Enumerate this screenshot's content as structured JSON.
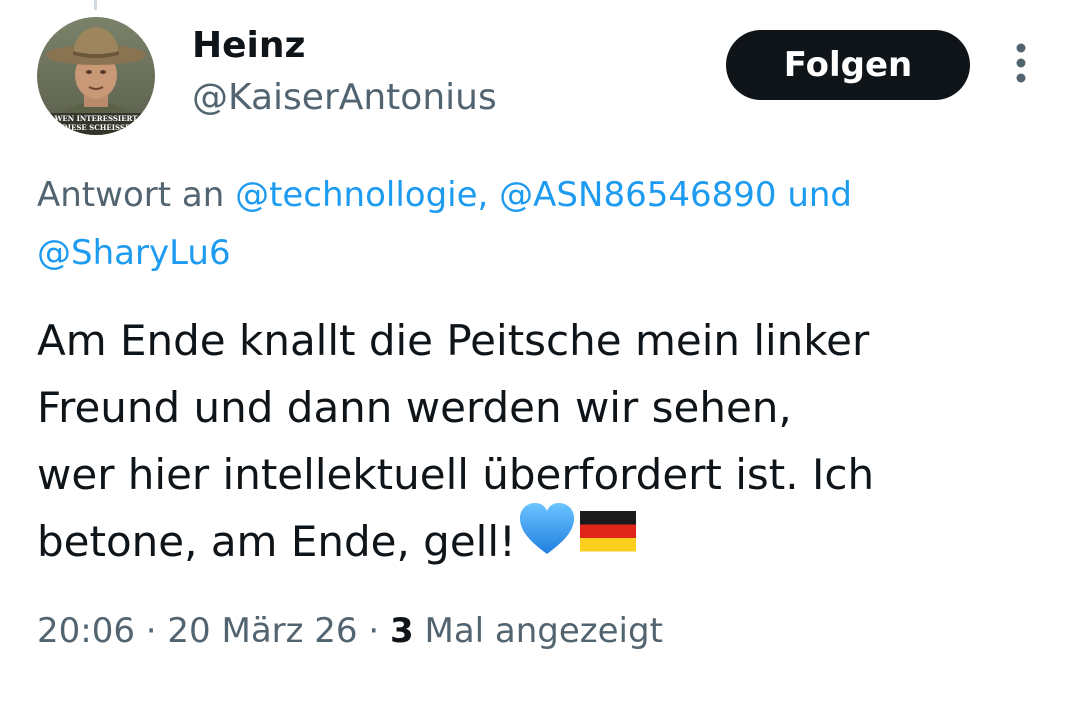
{
  "author": {
    "display_name": "Heinz",
    "handle": "@KaiserAntonius",
    "avatar_caption_line1": "WEN INTERESSIERT",
    "avatar_caption_line2": "DIESE SCHEISSE"
  },
  "actions": {
    "follow_label": "Folgen",
    "more_icon": "more-vertical-icon"
  },
  "reply": {
    "prefix": "Antwort an",
    "mentions": [
      "@technollogie,",
      "@ASN86546890"
    ],
    "conjunction": "und",
    "last_mention": "@SharyLu6"
  },
  "tweet": {
    "text_line1": "Am Ende knallt die Peitsche mein linker",
    "text_line2": "Freund und dann werden wir sehen,",
    "text_line3": "wer hier intellektuell überfordert ist. Ich",
    "text_line4": "betone,  am Ende, gell!",
    "emojis": [
      "blue-heart-icon",
      "germany-flag-icon"
    ]
  },
  "meta": {
    "time": "20:06",
    "separator": "·",
    "date": "20 März 26",
    "views_count": "3",
    "views_label": "Mal angezeigt"
  },
  "colors": {
    "text_primary": "#0f1419",
    "text_secondary": "#536471",
    "link": "#1d9bf0",
    "follow_bg": "#0f1419",
    "follow_text": "#ffffff"
  }
}
